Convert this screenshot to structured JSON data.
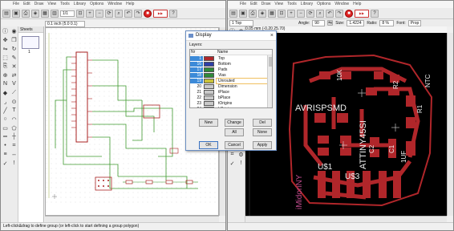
{
  "left_window": {
    "menu": [
      "File",
      "Edit",
      "Draw",
      "View",
      "Tools",
      "Library",
      "Options",
      "Window",
      "Help"
    ],
    "toolbar_zoom_value": "1/1",
    "grid_readout": "0.1 inch (5.0 0.1)",
    "sheets_title": "Sheets",
    "sheet_number": "1",
    "status_text": "Left-click&drag to define group (or left-click to start defining a group polygon)"
  },
  "right_window": {
    "menu": [
      "File",
      "Edit",
      "Draw",
      "View",
      "Tools",
      "Library",
      "Options",
      "Window",
      "Help"
    ],
    "layer_select": "1 Top",
    "angle_label": "Angle:",
    "angle_value": "90",
    "size_label": "Size:",
    "size_value": "1.4224",
    "ratio_label": "Ratio:",
    "ratio_value": "8 %",
    "font_label": "Font:",
    "font_value": "Prop",
    "coord_readout": "0.05 mm (-0.20 25.70)"
  },
  "board_labels": {
    "avrisp": "AVRISPSMD",
    "tiny": "ATTINY45SI",
    "u1": "U$1",
    "u2": "U$3",
    "c1": "C1",
    "c2": "C2",
    "r1": "R1",
    "r2": "R2",
    "ntc": "NTC",
    "k10": "10K",
    "uf": "1UF",
    "maker": "iMidoriNY"
  },
  "dialog": {
    "title": "Display",
    "layers_label": "Layers:",
    "col_nr": "Nr",
    "col_name": "Name",
    "layers": [
      {
        "nr": "1",
        "name": "Top",
        "color": "#b0262a",
        "sel": true
      },
      {
        "nr": "16",
        "name": "Bottom",
        "color": "#2e3fa8",
        "sel": true
      },
      {
        "nr": "17",
        "name": "Pads",
        "color": "#2f8a3a",
        "sel": true
      },
      {
        "nr": "18",
        "name": "Vias",
        "color": "#2f8a3a",
        "sel": true
      },
      {
        "nr": "19",
        "name": "Unrouted",
        "color": "#c9c23a",
        "sel": true
      },
      {
        "nr": "20",
        "name": "Dimension",
        "color": "#c9c9c9",
        "sel": false
      },
      {
        "nr": "21",
        "name": "tPlace",
        "color": "#c9c9c9",
        "sel": false
      },
      {
        "nr": "22",
        "name": "bPlace",
        "color": "#c9c9c9",
        "sel": false
      },
      {
        "nr": "23",
        "name": "tOrigins",
        "color": "#c9c9c9",
        "sel": false
      },
      {
        "nr": "24",
        "name": "bOrigins",
        "color": "#c9c9c9",
        "sel": false
      }
    ],
    "buttons": {
      "new": "New",
      "change": "Change",
      "del": "Del",
      "all": "All",
      "none": "None",
      "ok": "OK",
      "cancel": "Cancel",
      "apply": "Apply"
    }
  },
  "colors": {
    "board_bg": "#000000",
    "copper_top": "#b0262a",
    "pad": "#b0262a",
    "wire_green": "#3f9a2f",
    "selection_blue": "#3c8ad8"
  }
}
